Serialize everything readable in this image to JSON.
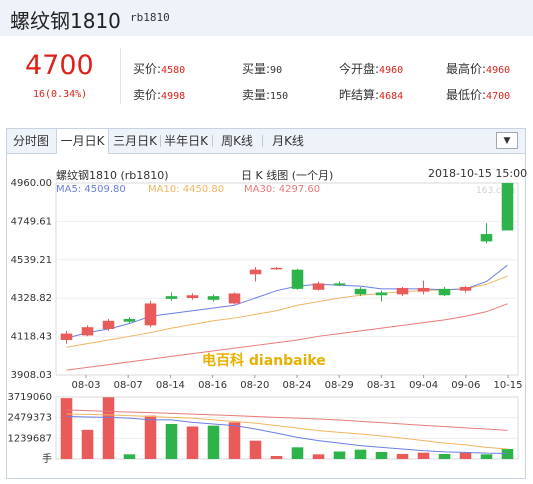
{
  "header": {
    "title": "螺纹钢1810",
    "code": "rb1810"
  },
  "quote": {
    "price": "4700",
    "change": "16(0.34%)",
    "fields": [
      {
        "label": "买价:",
        "value": "4580",
        "color": "red"
      },
      {
        "label": "买量:",
        "value": "90",
        "color": "dark"
      },
      {
        "label": "今开盘:",
        "value": "4960",
        "color": "red"
      },
      {
        "label": "最高价:",
        "value": "4960",
        "color": "red"
      },
      {
        "label": "卖价:",
        "value": "4998",
        "color": "red"
      },
      {
        "label": "卖量:",
        "value": "150",
        "color": "dark"
      },
      {
        "label": "昨结算:",
        "value": "4684",
        "color": "red"
      },
      {
        "label": "最低价:",
        "value": "4700",
        "color": "red"
      }
    ]
  },
  "tabs": [
    "分时图",
    "一月日K",
    "三月日K",
    "半年日K",
    "周K线",
    "月K线"
  ],
  "active_tab": "一月日K",
  "dropdown_icon": "triangle-down-icon",
  "chart_info": {
    "name": "螺纹钢1810 (rb1810)",
    "period": "日 K 线图 (一个月)",
    "datetime": "2018-10-15 15:00",
    "ma5": "MA5: 4509.80",
    "ma10": "MA10: 4450.80",
    "ma30": "MA30: 4297.60",
    "watermark": "电百科 dianbaike",
    "watermark2": "163.com"
  },
  "colors": {
    "up": "#e95a5a",
    "down": "#2db34a",
    "ma5": "#6b7ee0",
    "ma10": "#f1b563",
    "ma30": "#e87a7a",
    "accent": "#e0201a"
  },
  "chart_data": {
    "type": "candlestick",
    "price_ticks": [
      "4960.00",
      "4749.61",
      "4539.21",
      "4328.82",
      "4118.43",
      "3908.03"
    ],
    "ylim": [
      3908.03,
      4960.0
    ],
    "x_tick_labels": [
      "08-03",
      "08-07",
      "08-14",
      "08-16",
      "08-20",
      "08-24",
      "08-29",
      "08-31",
      "09-04",
      "09-06",
      "10-15"
    ],
    "candles": [
      {
        "o": 4100,
        "c": 4135,
        "h": 4150,
        "l": 4080,
        "dir": "up"
      },
      {
        "o": 4125,
        "c": 4170,
        "h": 4180,
        "l": 4120,
        "dir": "up"
      },
      {
        "o": 4160,
        "c": 4205,
        "h": 4215,
        "l": 4150,
        "dir": "up"
      },
      {
        "o": 4200,
        "c": 4215,
        "h": 4225,
        "l": 4190,
        "dir": "down"
      },
      {
        "o": 4180,
        "c": 4300,
        "h": 4315,
        "l": 4170,
        "dir": "up"
      },
      {
        "o": 4340,
        "c": 4325,
        "h": 4360,
        "l": 4315,
        "dir": "down"
      },
      {
        "o": 4330,
        "c": 4345,
        "h": 4355,
        "l": 4320,
        "dir": "up"
      },
      {
        "o": 4340,
        "c": 4320,
        "h": 4350,
        "l": 4310,
        "dir": "down"
      },
      {
        "o": 4300,
        "c": 4355,
        "h": 4360,
        "l": 4295,
        "dir": "up"
      },
      {
        "o": 4460,
        "c": 4485,
        "h": 4500,
        "l": 4420,
        "dir": "up"
      },
      {
        "o": 4495,
        "c": 4490,
        "h": 4500,
        "l": 4485,
        "dir": "up"
      },
      {
        "o": 4485,
        "c": 4380,
        "h": 4490,
        "l": 4375,
        "dir": "down"
      },
      {
        "o": 4410,
        "c": 4375,
        "h": 4420,
        "l": 4370,
        "dir": "up"
      },
      {
        "o": 4400,
        "c": 4410,
        "h": 4420,
        "l": 4395,
        "dir": "down"
      },
      {
        "o": 4380,
        "c": 4350,
        "h": 4390,
        "l": 4340,
        "dir": "down"
      },
      {
        "o": 4360,
        "c": 4345,
        "h": 4370,
        "l": 4310,
        "dir": "down"
      },
      {
        "o": 4350,
        "c": 4385,
        "h": 4390,
        "l": 4340,
        "dir": "up"
      },
      {
        "o": 4385,
        "c": 4365,
        "h": 4425,
        "l": 4350,
        "dir": "up"
      },
      {
        "o": 4380,
        "c": 4345,
        "h": 4390,
        "l": 4340,
        "dir": "down"
      },
      {
        "o": 4370,
        "c": 4390,
        "h": 4395,
        "l": 4360,
        "dir": "up"
      },
      {
        "o": 4640,
        "c": 4680,
        "h": 4740,
        "l": 4630,
        "dir": "down"
      },
      {
        "o": 4700,
        "c": 4960,
        "h": 4960,
        "l": 4700,
        "dir": "down"
      }
    ],
    "ma5": [
      4110,
      4140,
      4160,
      4190,
      4230,
      4245,
      4260,
      4275,
      4290,
      4330,
      4370,
      4395,
      4405,
      4400,
      4395,
      4380,
      4380,
      4380,
      4375,
      4380,
      4420,
      4510
    ],
    "ma10": [
      4060,
      4080,
      4100,
      4120,
      4140,
      4165,
      4185,
      4205,
      4220,
      4240,
      4260,
      4290,
      4310,
      4330,
      4345,
      4355,
      4365,
      4370,
      4375,
      4380,
      4405,
      4450
    ],
    "ma30": [
      3935,
      3950,
      3965,
      3980,
      3995,
      4010,
      4025,
      4040,
      4055,
      4070,
      4085,
      4100,
      4120,
      4135,
      4150,
      4165,
      4180,
      4195,
      4210,
      4230,
      4255,
      4298
    ],
    "volume_ticks": [
      "3719060",
      "2479373",
      "1239687",
      "手"
    ],
    "volume_max": 3719060,
    "volumes": [
      3650000,
      1750000,
      3700000,
      280000,
      2600000,
      2100000,
      1950000,
      2000000,
      2200000,
      1100000,
      180000,
      700000,
      280000,
      450000,
      560000,
      420000,
      300000,
      380000,
      300000,
      380000,
      280000,
      600000
    ],
    "vol_ma5": [
      2550000,
      2520000,
      2500000,
      2450000,
      2350000,
      2350000,
      2200000,
      2100000,
      2000000,
      1800000,
      1550000,
      1300000,
      1100000,
      950000,
      800000,
      700000,
      600000,
      500000,
      430000,
      400000,
      350000,
      330000
    ],
    "vol_ma10": [
      2700000,
      2680000,
      2650000,
      2600000,
      2550000,
      2500000,
      2450000,
      2350000,
      2250000,
      2150000,
      2000000,
      1850000,
      1700000,
      1600000,
      1500000,
      1380000,
      1250000,
      1100000,
      950000,
      850000,
      700000,
      600000
    ],
    "vol_ma30": [
      2950000,
      2900000,
      2860000,
      2820000,
      2780000,
      2740000,
      2690000,
      2650000,
      2600000,
      2550000,
      2500000,
      2450000,
      2400000,
      2340000,
      2260000,
      2180000,
      2100000,
      2020000,
      1950000,
      1870000,
      1800000,
      1720000
    ]
  }
}
